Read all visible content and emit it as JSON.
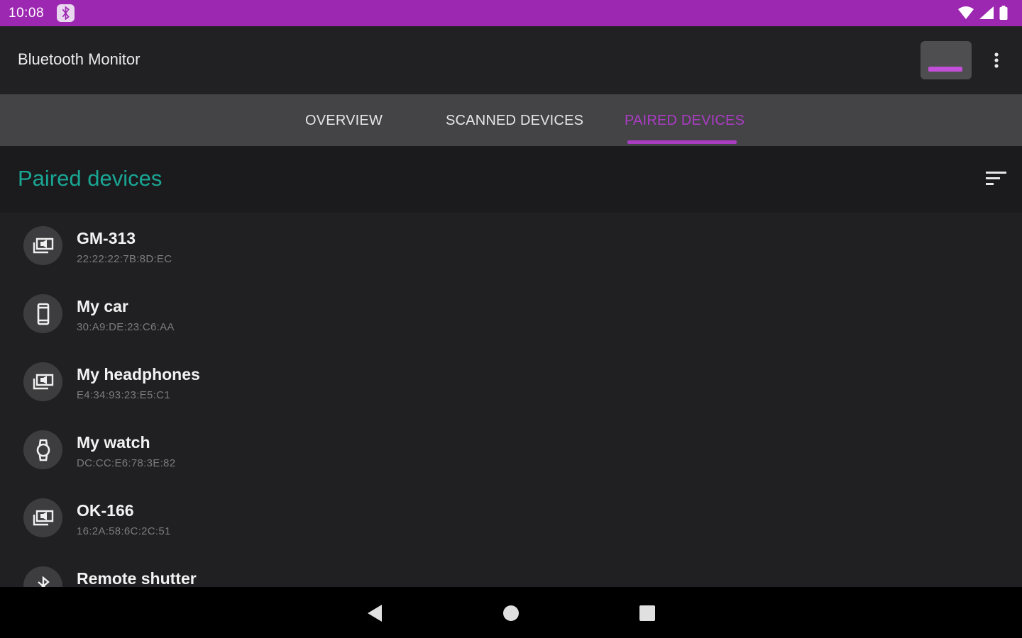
{
  "status_bar": {
    "time": "10:08"
  },
  "toolbar": {
    "title": "Bluetooth Monitor"
  },
  "tabs": [
    {
      "label": "OVERVIEW",
      "active": false
    },
    {
      "label": "SCANNED DEVICES",
      "active": false
    },
    {
      "label": "PAIRED DEVICES",
      "active": true
    }
  ],
  "section": {
    "title": "Paired devices"
  },
  "devices": [
    {
      "name": "GM-313",
      "mac": "22:22:22:7B:8D:EC",
      "icon": "audio-device-icon"
    },
    {
      "name": "My car",
      "mac": "30:A9:DE:23:C6:AA",
      "icon": "phone-device-icon"
    },
    {
      "name": "My headphones",
      "mac": "E4:34:93:23:E5:C1",
      "icon": "audio-device-icon"
    },
    {
      "name": "My watch",
      "mac": "DC:CC:E6:78:3E:82",
      "icon": "watch-icon"
    },
    {
      "name": "OK-166",
      "mac": "16:2A:58:6C:2C:51",
      "icon": "audio-device-icon"
    },
    {
      "name": "Remote shutter",
      "mac": "",
      "icon": "bluetooth-icon"
    }
  ],
  "colors": {
    "status_bar": "#9c27b0",
    "accent": "#ab3cc4",
    "section_title": "#1aa694",
    "background": "#1f1f21"
  }
}
